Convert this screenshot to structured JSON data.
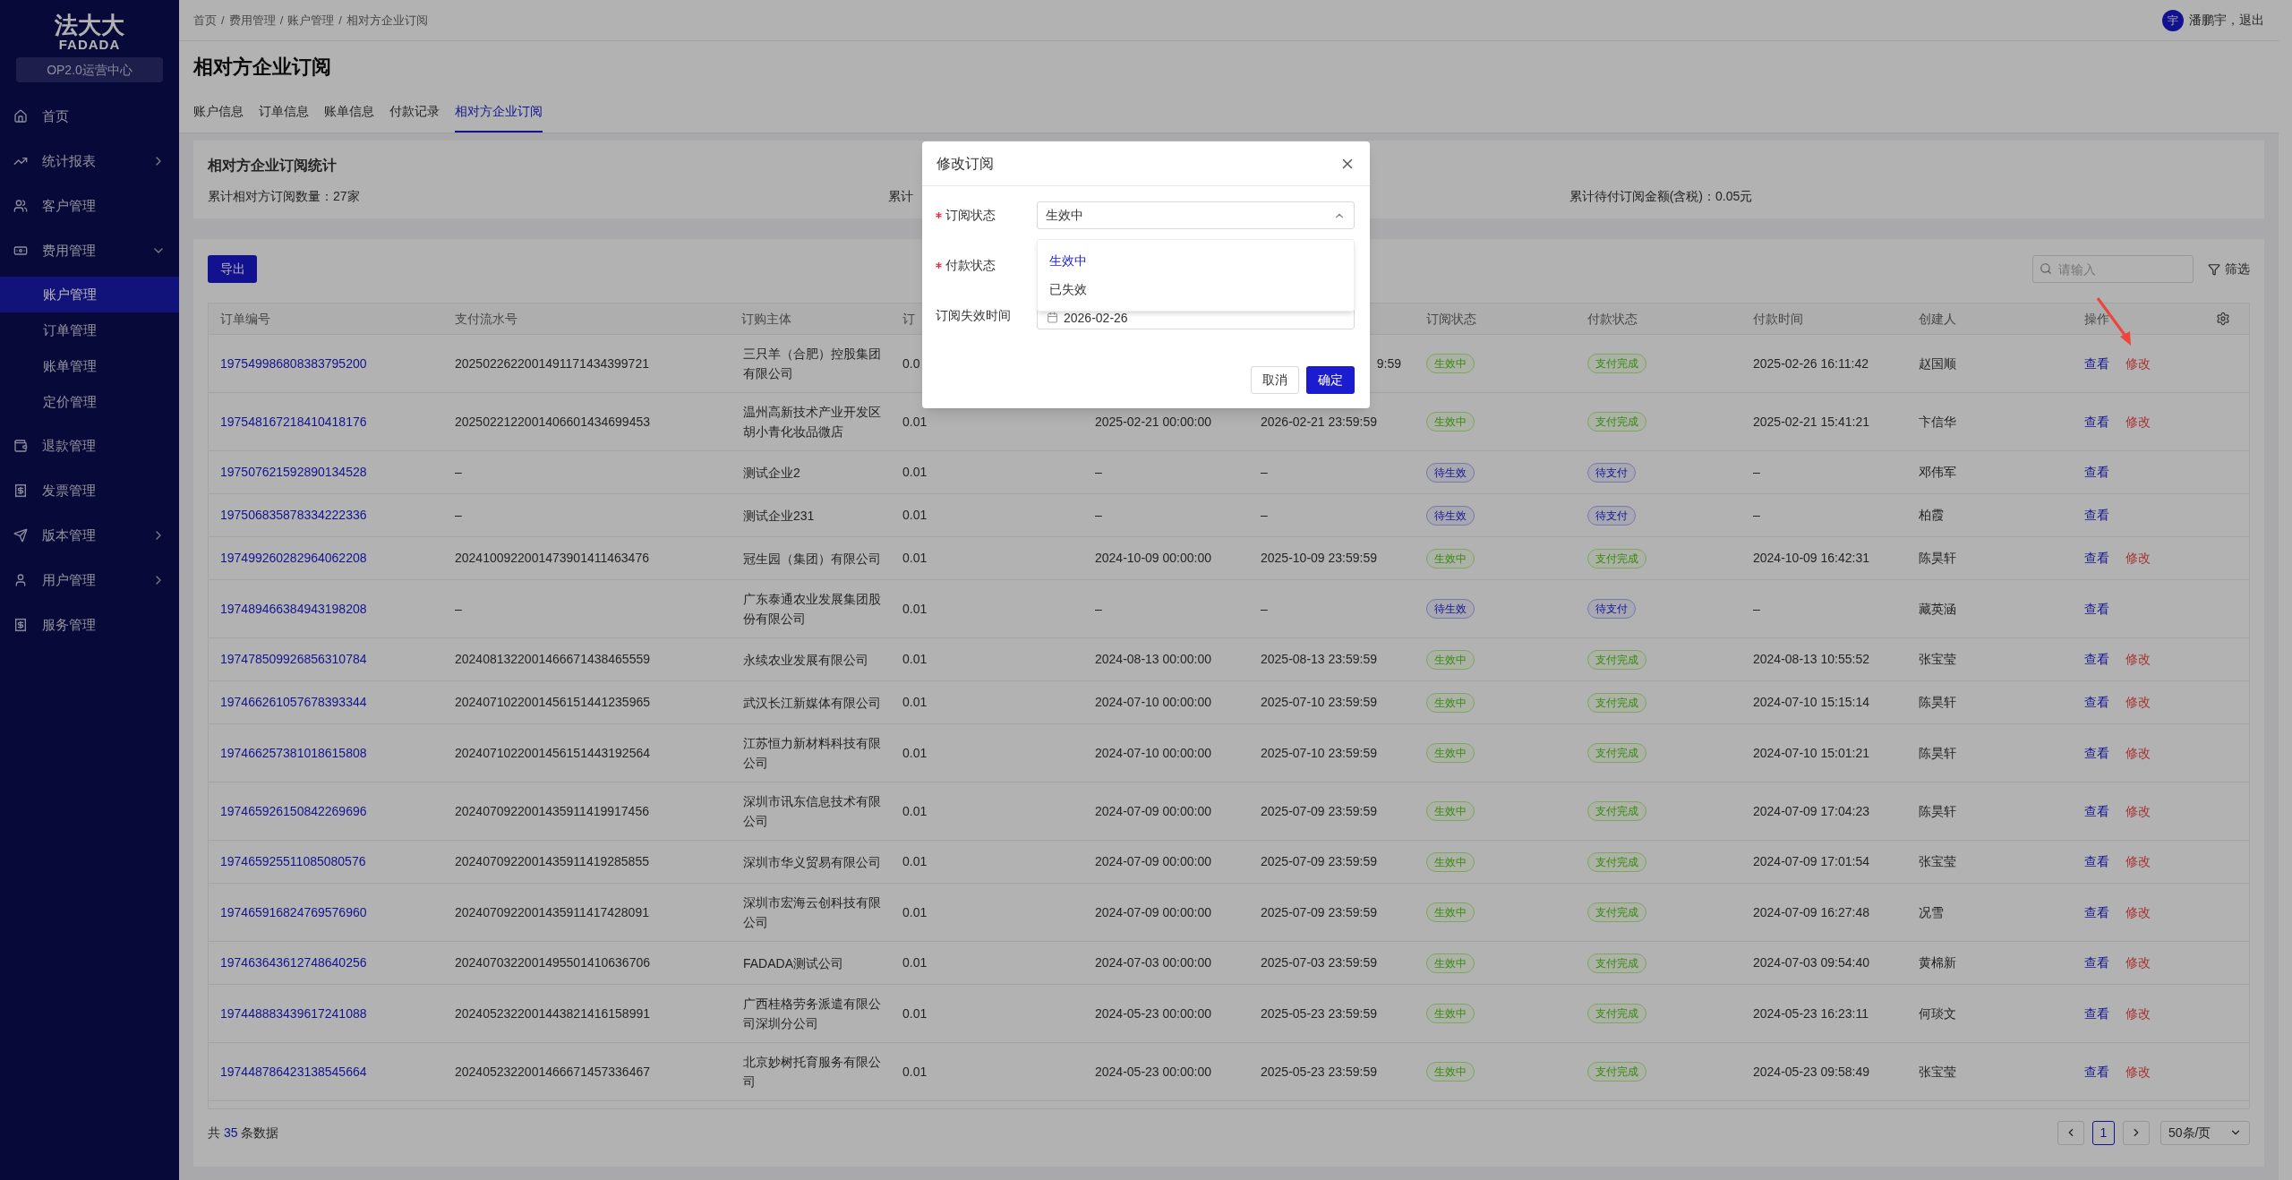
{
  "sidebar": {
    "logo_cn": "法大大",
    "logo_en": "FADADA",
    "center_badge": "OP2.0运营中心",
    "items": [
      {
        "label": "首页"
      },
      {
        "label": "统计报表",
        "expanded": false
      },
      {
        "label": "客户管理"
      },
      {
        "label": "费用管理",
        "expanded": true,
        "children": [
          {
            "label": "账户管理",
            "selected": true
          },
          {
            "label": "订单管理",
            "selected": false
          },
          {
            "label": "账单管理",
            "selected": false
          },
          {
            "label": "定价管理",
            "selected": false
          }
        ]
      },
      {
        "label": "退款管理"
      },
      {
        "label": "发票管理"
      },
      {
        "label": "版本管理",
        "expanded": false
      },
      {
        "label": "用户管理",
        "expanded": false
      },
      {
        "label": "服务管理"
      }
    ]
  },
  "header": {
    "breadcrumb": [
      "首页",
      "费用管理",
      "账户管理",
      "相对方企业订阅"
    ],
    "separator": "/",
    "avatar": "宇",
    "user": "潘鹏宇，",
    "logout": "退出"
  },
  "page_title": "相对方企业订阅",
  "tabs": [
    {
      "label": "账户信息",
      "selected": false
    },
    {
      "label": "订单信息",
      "selected": false
    },
    {
      "label": "账单信息",
      "selected": false
    },
    {
      "label": "付款记录",
      "selected": false
    },
    {
      "label": "相对方企业订阅",
      "selected": true
    }
  ],
  "stats": {
    "title": "相对方企业订阅统计",
    "items": [
      "累计相对方订阅数量：27家",
      "累计",
      "累计待付订阅金额(含税)：0.05元"
    ]
  },
  "toolbar": {
    "export": "导出",
    "search_placeholder": "请输入",
    "filter": "筛选"
  },
  "table": {
    "header": {
      "order_no": "订单编号",
      "payment_no": "支付流水号",
      "subject": "订购主体",
      "column_4": "订",
      "subscription_status": "订阅状态",
      "payment_status": "付款状态",
      "payment_time": "付款时间",
      "creator": "创建人",
      "actions": "操作"
    },
    "rows": [
      {
        "covered": true,
        "order_no": "197549986808383795200",
        "payment_no": "2025022622001491171434399721",
        "subject": "三只羊（合肥）控股集团有限公司",
        "column_4": "0.0",
        "column_6": "9:59",
        "subscription_status": {
          "text": "生效中",
          "kind": "active"
        },
        "payment_status": {
          "text": "支付完成",
          "kind": "done"
        },
        "payment_time": "2025-02-26 16:11:42",
        "creator": "赵国顺",
        "actions": [
          {
            "label": "查看",
            "kind": "view"
          },
          {
            "label": "修改",
            "kind": "edit"
          }
        ]
      },
      {
        "covered": false,
        "order_no": "197548167218410418176",
        "payment_no": "2025022122001406601434699453",
        "subject": "温州高新技术产业开发区胡小青化妆品微店",
        "column_4": "0.01",
        "column_5": "2025-02-21 00:00:00",
        "column_6": "2026-02-21 23:59:59",
        "subscription_status": {
          "text": "生效中",
          "kind": "active"
        },
        "payment_status": {
          "text": "支付完成",
          "kind": "done"
        },
        "payment_time": "2025-02-21 15:41:21",
        "creator": "卞信华",
        "actions": [
          {
            "label": "查看",
            "kind": "view"
          },
          {
            "label": "修改",
            "kind": "edit"
          }
        ]
      },
      {
        "covered": false,
        "order_no": "197507621592890134528",
        "payment_no": "–",
        "subject": "测试企业2",
        "column_4": "0.01",
        "column_5": "–",
        "column_6": "–",
        "subscription_status": {
          "text": "待生效",
          "kind": "pending"
        },
        "payment_status": {
          "text": "待支付",
          "kind": "pending"
        },
        "payment_time": "–",
        "creator": "邓伟军",
        "actions": [
          {
            "label": "查看",
            "kind": "view"
          }
        ]
      },
      {
        "covered": false,
        "order_no": "197506835878334222336",
        "payment_no": "–",
        "subject": "测试企业231",
        "column_4": "0.01",
        "column_5": "–",
        "column_6": "–",
        "subscription_status": {
          "text": "待生效",
          "kind": "pending"
        },
        "payment_status": {
          "text": "待支付",
          "kind": "pending"
        },
        "payment_time": "–",
        "creator": "柏霞",
        "actions": [
          {
            "label": "查看",
            "kind": "view"
          }
        ]
      },
      {
        "covered": false,
        "order_no": "197499260282964062208",
        "payment_no": "2024100922001473901411463476",
        "subject": "冠生园（集团）有限公司",
        "column_4": "0.01",
        "column_5": "2024-10-09 00:00:00",
        "column_6": "2025-10-09 23:59:59",
        "subscription_status": {
          "text": "生效中",
          "kind": "active"
        },
        "payment_status": {
          "text": "支付完成",
          "kind": "done"
        },
        "payment_time": "2024-10-09 16:42:31",
        "creator": "陈昊轩",
        "actions": [
          {
            "label": "查看",
            "kind": "view"
          },
          {
            "label": "修改",
            "kind": "edit"
          }
        ]
      },
      {
        "covered": false,
        "order_no": "197489466384943198208",
        "payment_no": "–",
        "subject": "广东泰通农业发展集团股份有限公司",
        "column_4": "0.01",
        "column_5": "–",
        "column_6": "–",
        "subscription_status": {
          "text": "待生效",
          "kind": "pending"
        },
        "payment_status": {
          "text": "待支付",
          "kind": "pending"
        },
        "payment_time": "–",
        "creator": "藏英涵",
        "actions": [
          {
            "label": "查看",
            "kind": "view"
          }
        ]
      },
      {
        "covered": false,
        "order_no": "197478509926856310784",
        "payment_no": "2024081322001466671438465559",
        "subject": "永续农业发展有限公司",
        "column_4": "0.01",
        "column_5": "2024-08-13 00:00:00",
        "column_6": "2025-08-13 23:59:59",
        "subscription_status": {
          "text": "生效中",
          "kind": "active"
        },
        "payment_status": {
          "text": "支付完成",
          "kind": "done"
        },
        "payment_time": "2024-08-13 10:55:52",
        "creator": "张宝莹",
        "actions": [
          {
            "label": "查看",
            "kind": "view"
          },
          {
            "label": "修改",
            "kind": "edit"
          }
        ]
      },
      {
        "covered": false,
        "order_no": "197466261057678393344",
        "payment_no": "2024071022001456151441235965",
        "subject": "武汉长江新媒体有限公司",
        "column_4": "0.01",
        "column_5": "2024-07-10 00:00:00",
        "column_6": "2025-07-10 23:59:59",
        "subscription_status": {
          "text": "生效中",
          "kind": "active"
        },
        "payment_status": {
          "text": "支付完成",
          "kind": "done"
        },
        "payment_time": "2024-07-10 15:15:14",
        "creator": "陈昊轩",
        "actions": [
          {
            "label": "查看",
            "kind": "view"
          },
          {
            "label": "修改",
            "kind": "edit"
          }
        ]
      },
      {
        "covered": false,
        "order_no": "197466257381018615808",
        "payment_no": "2024071022001456151443192564",
        "subject": "江苏恒力新材料科技有限公司",
        "column_4": "0.01",
        "column_5": "2024-07-10 00:00:00",
        "column_6": "2025-07-10 23:59:59",
        "subscription_status": {
          "text": "生效中",
          "kind": "active"
        },
        "payment_status": {
          "text": "支付完成",
          "kind": "done"
        },
        "payment_time": "2024-07-10 15:01:21",
        "creator": "陈昊轩",
        "actions": [
          {
            "label": "查看",
            "kind": "view"
          },
          {
            "label": "修改",
            "kind": "edit"
          }
        ]
      },
      {
        "covered": false,
        "order_no": "197465926150842269696",
        "payment_no": "2024070922001435911419917456",
        "subject": "深圳市讯东信息技术有限公司",
        "column_4": "0.01",
        "column_5": "2024-07-09 00:00:00",
        "column_6": "2025-07-09 23:59:59",
        "subscription_status": {
          "text": "生效中",
          "kind": "active"
        },
        "payment_status": {
          "text": "支付完成",
          "kind": "done"
        },
        "payment_time": "2024-07-09 17:04:23",
        "creator": "陈昊轩",
        "actions": [
          {
            "label": "查看",
            "kind": "view"
          },
          {
            "label": "修改",
            "kind": "edit"
          }
        ]
      },
      {
        "covered": false,
        "order_no": "197465925511085080576",
        "payment_no": "2024070922001435911419285855",
        "subject": "深圳市华义贸易有限公司",
        "column_4": "0.01",
        "column_5": "2024-07-09 00:00:00",
        "column_6": "2025-07-09 23:59:59",
        "subscription_status": {
          "text": "生效中",
          "kind": "active"
        },
        "payment_status": {
          "text": "支付完成",
          "kind": "done"
        },
        "payment_time": "2024-07-09 17:01:54",
        "creator": "张宝莹",
        "actions": [
          {
            "label": "查看",
            "kind": "view"
          },
          {
            "label": "修改",
            "kind": "edit"
          }
        ]
      },
      {
        "covered": false,
        "order_no": "197465916824769576960",
        "payment_no": "2024070922001435911417428091",
        "subject": "深圳市宏海云创科技有限公司",
        "column_4": "0.01",
        "column_5": "2024-07-09 00:00:00",
        "column_6": "2025-07-09 23:59:59",
        "subscription_status": {
          "text": "生效中",
          "kind": "active"
        },
        "payment_status": {
          "text": "支付完成",
          "kind": "done"
        },
        "payment_time": "2024-07-09 16:27:48",
        "creator": "况雪",
        "actions": [
          {
            "label": "查看",
            "kind": "view"
          },
          {
            "label": "修改",
            "kind": "edit"
          }
        ]
      },
      {
        "covered": false,
        "order_no": "197463643612748640256",
        "payment_no": "2024070322001495501410636706",
        "subject": "FADADA测试公司",
        "column_4": "0.01",
        "column_5": "2024-07-03 00:00:00",
        "column_6": "2025-07-03 23:59:59",
        "subscription_status": {
          "text": "生效中",
          "kind": "active"
        },
        "payment_status": {
          "text": "支付完成",
          "kind": "done"
        },
        "payment_time": "2024-07-03 09:54:40",
        "creator": "黄棉新",
        "actions": [
          {
            "label": "查看",
            "kind": "view"
          },
          {
            "label": "修改",
            "kind": "edit"
          }
        ]
      },
      {
        "covered": false,
        "order_no": "197448883439617241088",
        "payment_no": "2024052322001443821416158991",
        "subject": "广西桂格劳务派遣有限公司深圳分公司",
        "column_4": "0.01",
        "column_5": "2024-05-23 00:00:00",
        "column_6": "2025-05-23 23:59:59",
        "subscription_status": {
          "text": "生效中",
          "kind": "active"
        },
        "payment_status": {
          "text": "支付完成",
          "kind": "done"
        },
        "payment_time": "2024-05-23 16:23:11",
        "creator": "何琰文",
        "actions": [
          {
            "label": "查看",
            "kind": "view"
          },
          {
            "label": "修改",
            "kind": "edit"
          }
        ]
      },
      {
        "covered": false,
        "order_no": "197448786423138545664",
        "payment_no": "2024052322001466671457336467",
        "subject": "北京妙树托育服务有限公司",
        "column_4": "0.01",
        "column_5": "2024-05-23 00:00:00",
        "column_6": "2025-05-23 23:59:59",
        "subscription_status": {
          "text": "生效中",
          "kind": "active"
        },
        "payment_status": {
          "text": "支付完成",
          "kind": "done"
        },
        "payment_time": "2024-05-23 09:58:49",
        "creator": "张宝莹",
        "actions": [
          {
            "label": "查看",
            "kind": "view"
          },
          {
            "label": "修改",
            "kind": "edit"
          }
        ]
      }
    ]
  },
  "footer": {
    "total_prefix": "共",
    "total": "35",
    "total_suffix": "条数据",
    "page": {
      "label": "1",
      "selected": true
    },
    "page_size": "50条/页"
  },
  "dialog": {
    "title": "修改订阅",
    "fields": [
      {
        "kind": "select",
        "label": "订阅状态",
        "required": true,
        "value": "生效中",
        "open": true,
        "options": [
          {
            "label": "生效中",
            "selected": true
          },
          {
            "label": "已失效",
            "selected": false
          }
        ]
      },
      {
        "kind": "select",
        "label": "付款状态",
        "required": true
      },
      {
        "kind": "date",
        "label": "订阅失效时间",
        "required": false,
        "value": "2026-02-26"
      }
    ],
    "buttons": [
      {
        "label": "取消",
        "kind": "secondary"
      },
      {
        "label": "确定",
        "kind": "primary"
      }
    ]
  }
}
